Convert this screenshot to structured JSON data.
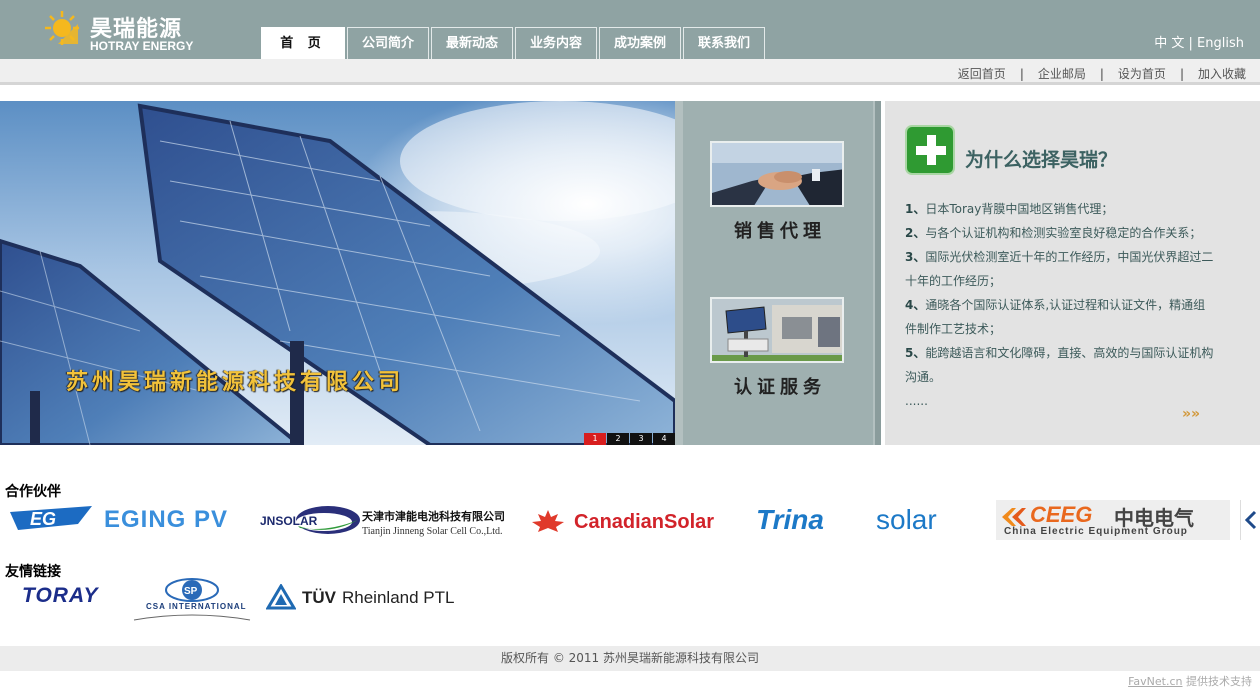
{
  "header": {
    "logo_cn": "昊瑞能源",
    "logo_en": "HOTRAY ENERGY",
    "lang_cn": "中 文",
    "lang_sep": "|",
    "lang_en": "English"
  },
  "nav": {
    "home": "首 页",
    "about": "公司简介",
    "news": "最新动态",
    "business": "业务内容",
    "cases": "成功案例",
    "contact": "联系我们"
  },
  "toplinks": {
    "back_home": "返回首页",
    "mail": "企业邮局",
    "set_home": "设为首页",
    "favorite": "加入收藏",
    "sep": "|"
  },
  "banner": {
    "caption": "苏州昊瑞新能源科技有限公司",
    "pager": [
      "1",
      "2",
      "3",
      "4"
    ]
  },
  "services": {
    "sales": "销售代理",
    "cert": "认证服务"
  },
  "why": {
    "title": "为什么选择昊瑞？",
    "items": [
      {
        "num": "1、",
        "text": "日本Toray背膜中国地区销售代理；"
      },
      {
        "num": "2、",
        "text": "与各个认证机构和检测实验室良好稳定的合作关系；"
      },
      {
        "num": "3、",
        "text": "国际光伏检测室近十年的工作经历，中国光伏界超过二十年的工作经历；"
      },
      {
        "num": "4、",
        "text": "通晓各个国际认证体系,认证过程和认证文件，精通组件制作工艺技术；"
      },
      {
        "num": "5、",
        "text": "能跨越语言和文化障碍，直接、高效的与国际认证机构沟通。"
      }
    ],
    "ellipsis": "......",
    "more": "»»"
  },
  "partners": {
    "title": "合作伙伴",
    "eging": "EGING PV",
    "eging_mark": "EG",
    "jn_en": "JNSOLAR",
    "jn_cn": "天津市津能电池科技有限公司",
    "jn_sub": "Tianjin Jinneng Solar Cell Co.,Ltd.",
    "canadian": "CanadianSolar",
    "trina_a": "Trina",
    "trina_b": "solar",
    "ceeg_a": "CEEG",
    "ceeg_b": "中电电气",
    "ceeg_sub": "China Electric Equipment Group"
  },
  "friends": {
    "title": "友情链接",
    "toray": "TORAY",
    "csa": "CSA INTERNATIONAL",
    "csa_mark": "SP",
    "tuv_a": "TÜV",
    "tuv_b": "Rheinland PTL"
  },
  "footer": {
    "copyright": "版权所有 © 2011 苏州昊瑞新能源科技有限公司",
    "tech_a": "FavNet.cn",
    "tech_b": "提供技术支持"
  },
  "colors": {
    "header_bg": "#8fa3a3",
    "accent_green": "#2f9a32",
    "pager_active": "#d81e1e",
    "caption_gold": "#f2c23a"
  }
}
